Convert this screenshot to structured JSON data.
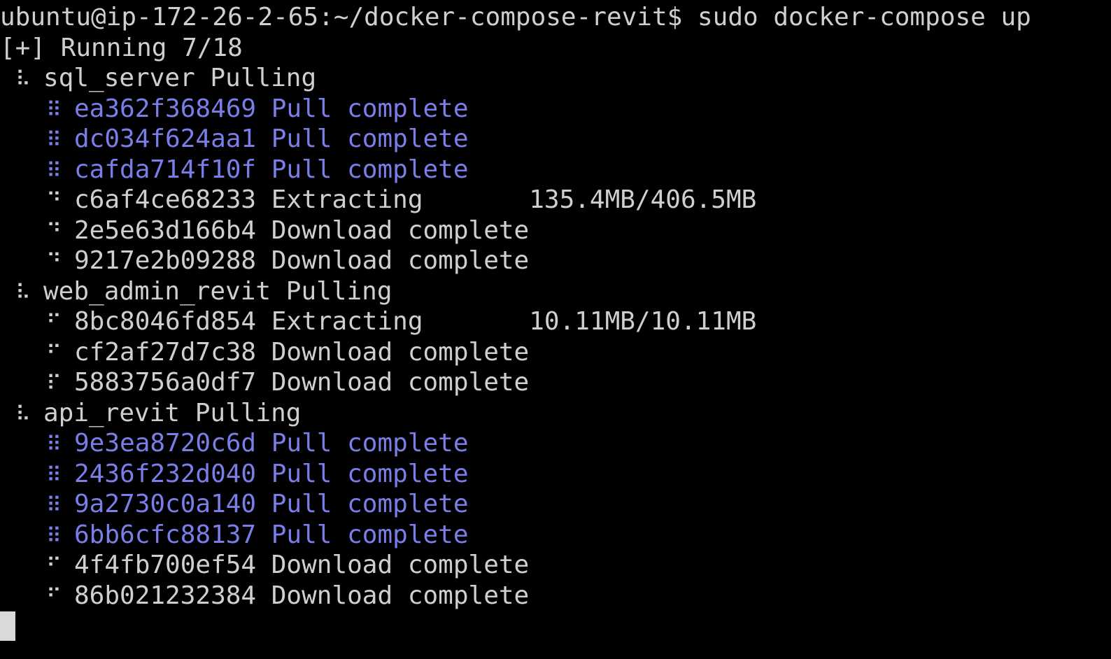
{
  "colors": {
    "background": "#000000",
    "text": "#cfcfcf",
    "complete_blue": "#7a7ee8",
    "cursor": "#d9d9d9"
  },
  "prompt": {
    "text": "ubuntu@ip-172-26-2-65:~/docker-compose-revit$ sudo docker-compose up"
  },
  "status": {
    "text": "[+] Running 7/18"
  },
  "services": [
    {
      "name_line": "sql_server Pulling",
      "spinner": "⠧",
      "layers": [
        {
          "spinner": "⠿",
          "text": "ea362f368469 Pull complete",
          "state": "complete"
        },
        {
          "spinner": "⠿",
          "text": "dc034f624aa1 Pull complete",
          "state": "complete"
        },
        {
          "spinner": "⠿",
          "text": "cafda714f10f Pull complete",
          "state": "complete"
        },
        {
          "spinner": "⠙",
          "text": "c6af4ce68233 Extracting       135.4MB/406.5MB",
          "state": "active"
        },
        {
          "spinner": "⠙",
          "text": "2e5e63d166b4 Download complete",
          "state": "active"
        },
        {
          "spinner": "⠙",
          "text": "9217e2b09288 Download complete",
          "state": "active"
        }
      ]
    },
    {
      "name_line": "web_admin_revit Pulling",
      "spinner": "⠧",
      "layers": [
        {
          "spinner": "⠋",
          "text": "8bc8046fd854 Extracting       10.11MB/10.11MB",
          "state": "active"
        },
        {
          "spinner": "⠋",
          "text": "cf2af27d7c38 Download complete",
          "state": "active"
        },
        {
          "spinner": "⠏",
          "text": "5883756a0df7 Download complete",
          "state": "active"
        }
      ]
    },
    {
      "name_line": "api_revit Pulling",
      "spinner": "⠧",
      "layers": [
        {
          "spinner": "⠿",
          "text": "9e3ea8720c6d Pull complete",
          "state": "complete"
        },
        {
          "spinner": "⠿",
          "text": "2436f232d040 Pull complete",
          "state": "complete"
        },
        {
          "spinner": "⠿",
          "text": "9a2730c0a140 Pull complete",
          "state": "complete"
        },
        {
          "spinner": "⠿",
          "text": "6bb6cfc88137 Pull complete",
          "state": "complete"
        },
        {
          "spinner": "⠋",
          "text": "4f4fb700ef54 Download complete",
          "state": "active"
        },
        {
          "spinner": "⠋",
          "text": "86b021232384 Download complete",
          "state": "active"
        }
      ]
    }
  ]
}
